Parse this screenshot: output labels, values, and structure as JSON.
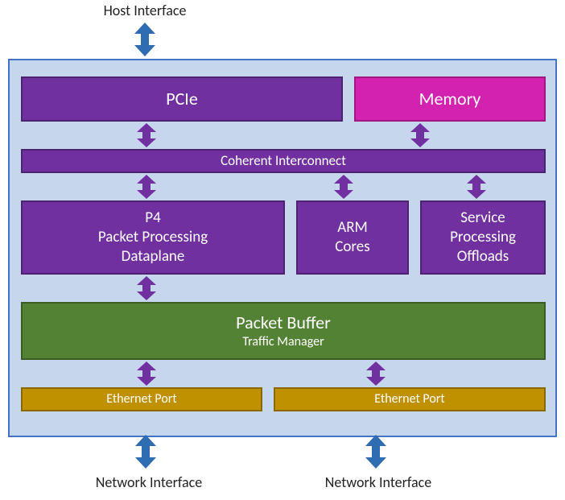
{
  "external": {
    "top_label": "Host Interface",
    "bottom_left_label": "Network Interface",
    "bottom_right_label": "Network Interface"
  },
  "blocks": {
    "pcie": "PCIe",
    "memory": "Memory",
    "interconnect": "Coherent Interconnect",
    "p4_line1": "P4",
    "p4_line2": "Packet Processing",
    "p4_line3": "Dataplane",
    "arm_line1": "ARM",
    "arm_line2": "Cores",
    "svc_line1": "Service",
    "svc_line2": "Processing",
    "svc_line3": "Offloads",
    "buffer_line1": "Packet Buffer",
    "buffer_line2": "Traffic Manager",
    "eth_left": "Ethernet Port",
    "eth_right": "Ethernet Port"
  },
  "colors": {
    "container_fill": "#c6d7ed",
    "container_border": "#4472c4",
    "purple": "#7030a0",
    "magenta": "#d321b0",
    "green": "#548235",
    "gold": "#bf9000",
    "arrow_blue": "#2f6db3",
    "arrow_purple": "#7030a0"
  }
}
